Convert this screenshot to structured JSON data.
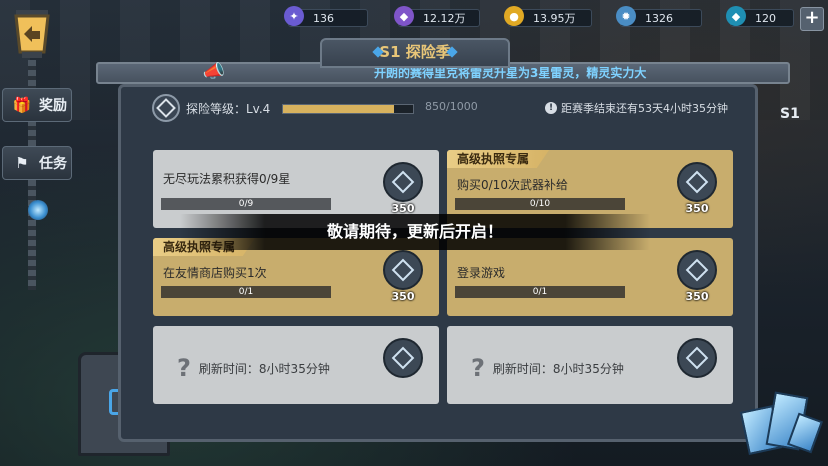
{
  "currency": [
    {
      "name": "ticket-icon",
      "value": "136",
      "color": "#6a5bd1"
    },
    {
      "name": "crystal-purple-icon",
      "value": "12.12万",
      "color": "#7f55c9"
    },
    {
      "name": "gold-coin-icon",
      "value": "13.95万",
      "color": "#e0a924"
    },
    {
      "name": "gear-coin-icon",
      "value": "1326",
      "color": "#4a8dc4"
    },
    {
      "name": "diamond-icon",
      "value": "120",
      "color": "#5fd7f0"
    }
  ],
  "plus_label": "+",
  "sidebar": {
    "reward_label": "奖励",
    "task_label": "任务"
  },
  "season": {
    "title": "S1 探险季"
  },
  "banner": {
    "text": "开朗的赛得里克将雷灵升星为3星雷灵，精灵实力大"
  },
  "level": {
    "label": "探险等级：Lv.4",
    "progress_text": "850/1000",
    "progress": 0.85,
    "timer": "距赛季结束还有53天4小时35分钟",
    "timer_icon": "!"
  },
  "cards": [
    {
      "title": "无尽玩法累积获得0/9星",
      "progress": "0/9",
      "reward": "350",
      "tag": ""
    },
    {
      "title": "购买0/10次武器补给",
      "progress": "0/10",
      "reward": "350",
      "tag": "高级执照专属"
    },
    {
      "title": "在友情商店购买1次",
      "progress": "0/1",
      "reward": "350",
      "tag": "高级执照专属"
    },
    {
      "title": "登录游戏",
      "progress": "0/1",
      "reward": "350",
      "tag": ""
    }
  ],
  "refresh": {
    "text": "刷新时间：8小时35分钟",
    "icon": "?"
  },
  "overlay": {
    "text": "敬请期待，更新后开启！"
  },
  "peek": "S1"
}
